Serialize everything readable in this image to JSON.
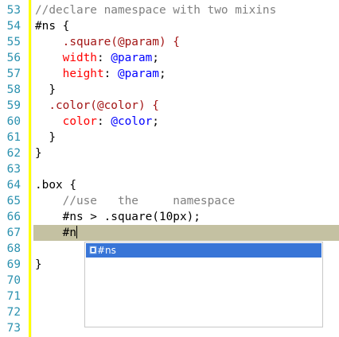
{
  "editor": {
    "line_numbers": [
      "53",
      "54",
      "55",
      "56",
      "57",
      "58",
      "59",
      "60",
      "61",
      "62",
      "63",
      "64",
      "65",
      "66",
      "67",
      "68",
      "69",
      "70",
      "71",
      "72",
      "73"
    ],
    "lines": {
      "l53": "//declare namespace with two mixins",
      "l54": "#ns {",
      "l55": "    .square(@param) {",
      "l56_prop": "    width",
      "l56_val": "@param",
      "l57_prop": "    height",
      "l57_val": "@param",
      "l58": "  }",
      "l59": "  .color(@color) {",
      "l60_prop": "    color",
      "l60_val": "@color",
      "l61": "  }",
      "l62": "}",
      "l64": ".box {",
      "l65": "    //use   the     namespace",
      "l66": "    #ns > .square(10px);",
      "l67": "    #n",
      "l69": "}"
    }
  },
  "autocomplete": {
    "item_label": "#ns",
    "item_icon": "less-mixin-icon"
  },
  "colors": {
    "comment": "#808080",
    "mixin": "#a31515",
    "property": "#ff0000",
    "value": "#0000ff",
    "line_number": "#2b91af",
    "current_line": "#c4c1a2",
    "selection": "#3875d7"
  }
}
